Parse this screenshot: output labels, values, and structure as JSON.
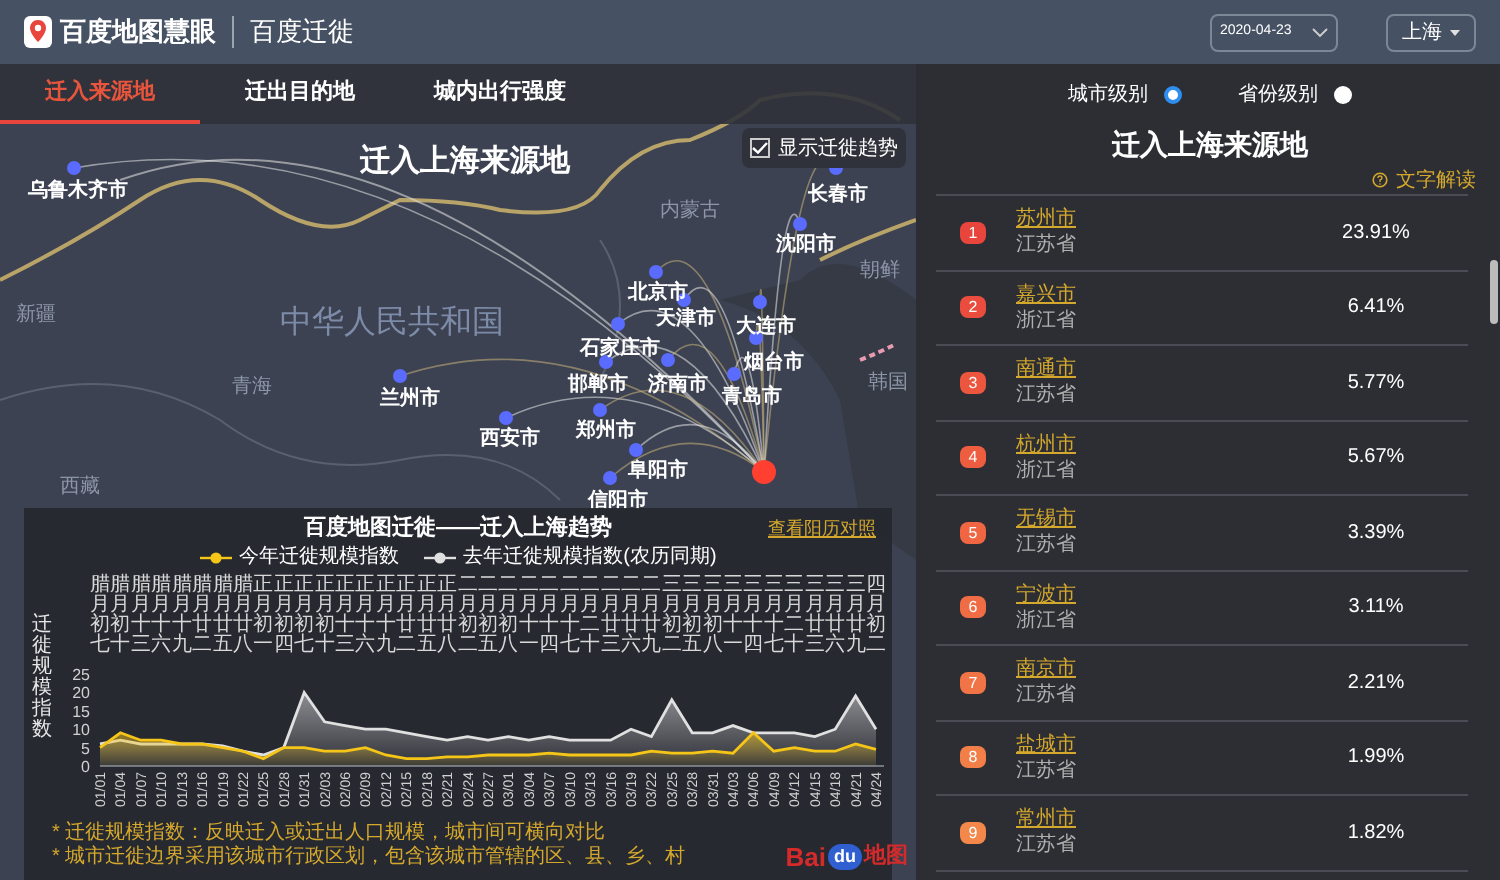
{
  "header": {
    "logo_text": "百度地图慧眼",
    "app_title": "百度迁徙",
    "date": "2020-04-23",
    "city": "上海"
  },
  "tabs": [
    {
      "label": "迁入来源地",
      "selected": true
    },
    {
      "label": "迁出目的地",
      "selected": false
    },
    {
      "label": "城内出行强度",
      "selected": false
    }
  ],
  "map": {
    "title": "迁入上海来源地",
    "show_trend": {
      "label": "显示迁徙趋势",
      "checked": true
    },
    "country_label": "中华人民共和国",
    "regions": [
      "内蒙古",
      "新疆",
      "青海",
      "西藏",
      "朝鲜",
      "韩国"
    ],
    "cities": [
      "乌鲁木齐市",
      "长春市",
      "沈阳市",
      "北京市",
      "天津市",
      "大连市",
      "石家庄市",
      "烟台市",
      "邯郸市",
      "济南市",
      "青岛市",
      "兰州市",
      "西安市",
      "郑州市",
      "阜阳市",
      "信阳市"
    ],
    "logo": {
      "part_1": "Bai",
      "part_2": "du",
      "part_3": "地图"
    }
  },
  "trend_chart": {
    "title": "百度地图迁徙——迁入上海趋势",
    "link": "查看阳历对照",
    "lunar_labels": [
      "腊月初七",
      "腊月初十",
      "腊月十三",
      "腊月十六",
      "腊月十九",
      "腊月廿二",
      "腊月廿五",
      "腊月廿八",
      "正月初一",
      "正月初四",
      "正月初七",
      "正月初十",
      "正月十三",
      "正月十六",
      "正月十九",
      "正月廿二",
      "正月廿五",
      "正月廿八",
      "二月初二",
      "二月初五",
      "二月初八",
      "二月十一",
      "二月十四",
      "二月十七",
      "二月二十",
      "二月廿三",
      "二月廿六",
      "二月廿九",
      "三月初二",
      "三月初五",
      "三月初八",
      "三月十一",
      "三月十四",
      "三月十七",
      "三月二十",
      "三月廿三",
      "三月廿六",
      "三月廿九",
      "四月初二"
    ],
    "chart_data": {
      "type": "area",
      "ylabel": "迁徙规模指数",
      "ylim": [
        0,
        25
      ],
      "yticks": [
        0,
        5,
        10,
        15,
        20,
        25
      ],
      "categories": [
        "01/01",
        "01/04",
        "01/07",
        "01/10",
        "01/13",
        "01/16",
        "01/19",
        "01/22",
        "01/25",
        "01/28",
        "01/31",
        "02/03",
        "02/06",
        "02/09",
        "02/12",
        "02/15",
        "02/18",
        "02/21",
        "02/24",
        "02/27",
        "03/01",
        "03/04",
        "03/07",
        "03/10",
        "03/13",
        "03/16",
        "03/19",
        "03/22",
        "03/25",
        "03/28",
        "03/31",
        "04/03",
        "04/06",
        "04/09",
        "04/12",
        "04/15",
        "04/18",
        "04/21",
        "04/24"
      ],
      "series": [
        {
          "name": "今年迁徙规模指数",
          "color": "#f5c518",
          "values": [
            5,
            9,
            7,
            7,
            6,
            6,
            5,
            4,
            2,
            5,
            5,
            4,
            4,
            5,
            3,
            2,
            2,
            2.5,
            2.5,
            3,
            3,
            3,
            3.5,
            3,
            3,
            3,
            3,
            4,
            3.5,
            3.5,
            4,
            3.5,
            9,
            4,
            5,
            4,
            4,
            6,
            4.5
          ]
        },
        {
          "name": "去年迁徙规模指数(农历同期)",
          "color": "#e0e0e0",
          "values": [
            6,
            7,
            6,
            6,
            6,
            6,
            5.5,
            4,
            3,
            5,
            20,
            12,
            11,
            10,
            10,
            9,
            8,
            7,
            8,
            7,
            8,
            7,
            8,
            7,
            7,
            7,
            10,
            8,
            18,
            9,
            9,
            11,
            9,
            9,
            9,
            8,
            10,
            19,
            10
          ]
        }
      ]
    },
    "notes": [
      "* 迁徙规模指数：反映迁入或迁出人口规模，城市间可横向对比",
      "* 城市迁徙边界采用该城市行政区划，包含该城市管辖的区、县、乡、村"
    ]
  },
  "ranking": {
    "levels": [
      {
        "label": "城市级别",
        "selected": true
      },
      {
        "label": "省份级别",
        "selected": false
      }
    ],
    "title": "迁入上海来源地",
    "explain_link": "文字解读",
    "rows": [
      {
        "rank": "1",
        "color": "#e8453c",
        "city": "苏州市",
        "province": "江苏省",
        "share": "23.91%"
      },
      {
        "rank": "2",
        "color": "#ea4d3d",
        "city": "嘉兴市",
        "province": "浙江省",
        "share": "6.41%"
      },
      {
        "rank": "3",
        "color": "#ec553e",
        "city": "南通市",
        "province": "江苏省",
        "share": "5.77%"
      },
      {
        "rank": "4",
        "color": "#ee5d40",
        "city": "杭州市",
        "province": "浙江省",
        "share": "5.67%"
      },
      {
        "rank": "5",
        "color": "#f06542",
        "city": "无锡市",
        "province": "江苏省",
        "share": "3.39%"
      },
      {
        "rank": "6",
        "color": "#f06c44",
        "city": "宁波市",
        "province": "浙江省",
        "share": "3.11%"
      },
      {
        "rank": "7",
        "color": "#f17446",
        "city": "南京市",
        "province": "江苏省",
        "share": "2.21%"
      },
      {
        "rank": "8",
        "color": "#f27e48",
        "city": "盐城市",
        "province": "江苏省",
        "share": "1.99%"
      },
      {
        "rank": "9",
        "color": "#f3884a",
        "city": "常州市",
        "province": "江苏省",
        "share": "1.82%"
      }
    ]
  }
}
